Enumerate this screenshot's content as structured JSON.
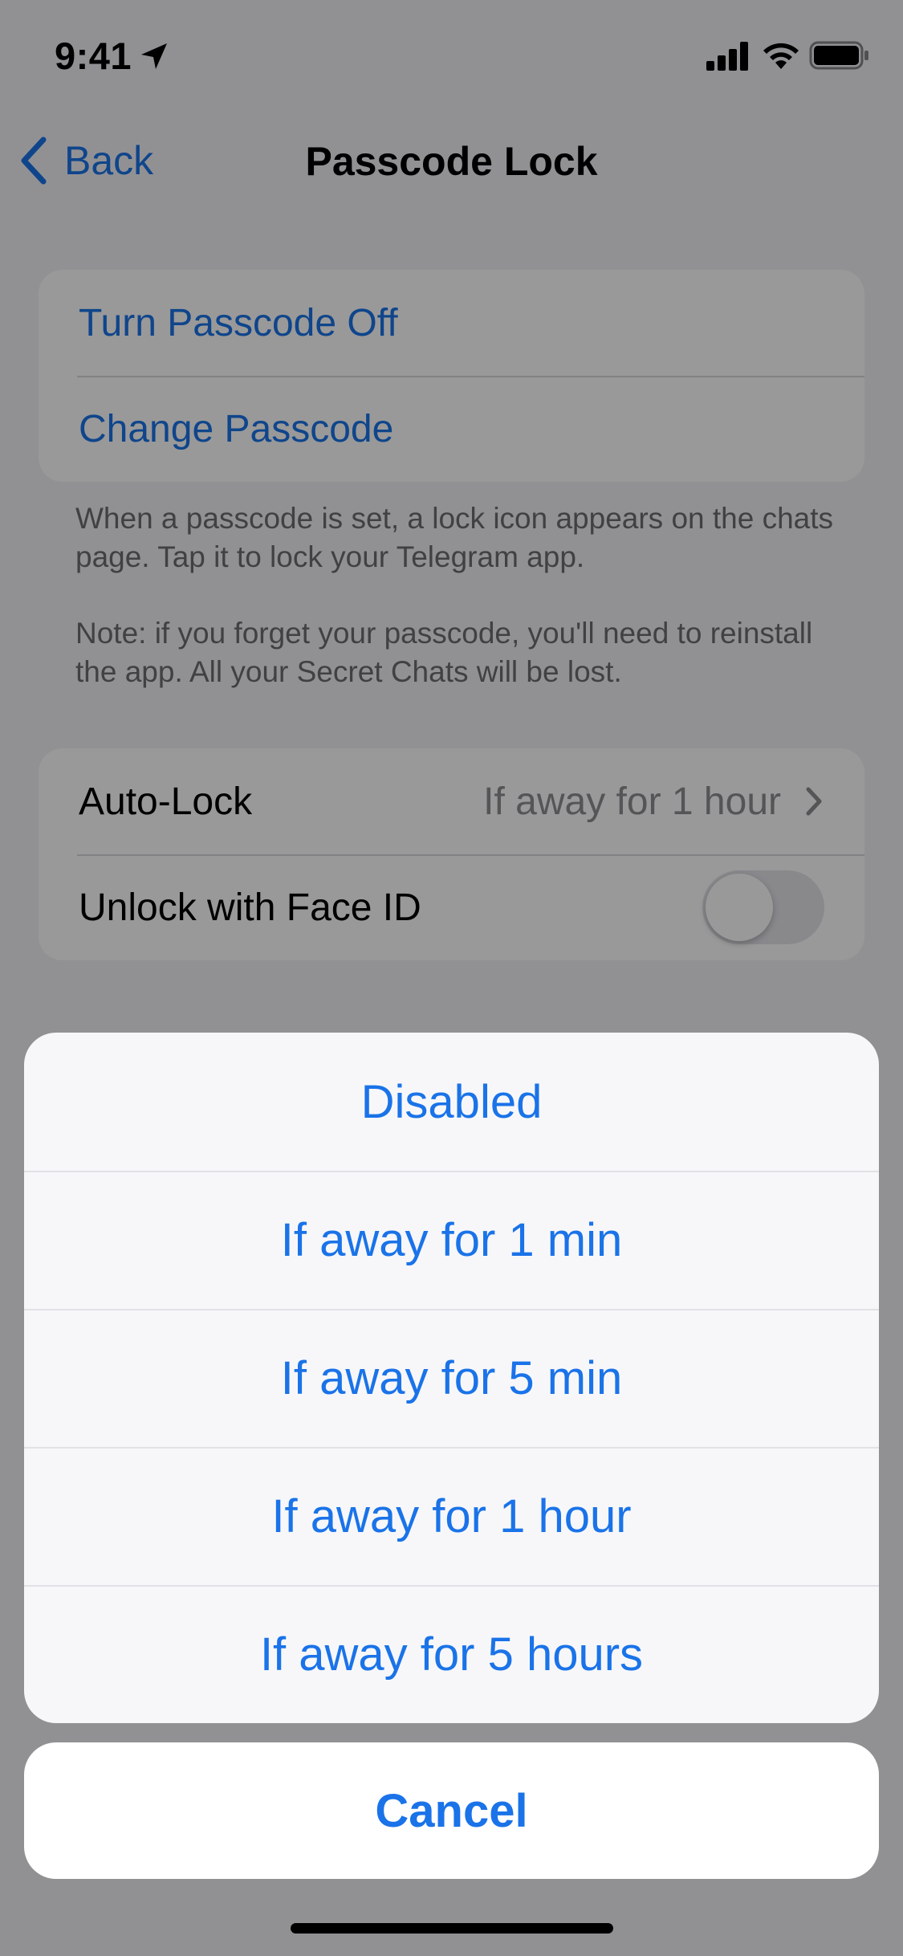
{
  "status": {
    "time": "9:41"
  },
  "nav": {
    "back_label": "Back",
    "title": "Passcode Lock"
  },
  "passcode_group": {
    "items": [
      {
        "label": "Turn Passcode Off"
      },
      {
        "label": "Change Passcode"
      }
    ]
  },
  "notes": {
    "info": "When a passcode is set, a lock icon appears on the chats page. Tap it to lock your Telegram app.",
    "warning": "Note: if you forget your passcode, you'll need to reinstall the app. All your Secret Chats will be lost."
  },
  "settings_group": {
    "auto_lock_label": "Auto-Lock",
    "auto_lock_value": "If away for 1 hour",
    "face_id_label": "Unlock with Face ID",
    "face_id_enabled": false
  },
  "action_sheet": {
    "options": [
      {
        "label": "Disabled"
      },
      {
        "label": "If away for 1 min"
      },
      {
        "label": "If away for 5 min"
      },
      {
        "label": "If away for 1 hour"
      },
      {
        "label": "If away for 5 hours"
      }
    ],
    "cancel_label": "Cancel"
  },
  "colors": {
    "accent": "#1a73e8",
    "background": "#f2f2f7",
    "secondary_text": "#6d6d72"
  },
  "icons": [
    "location-arrow-icon",
    "cellular-signal-icon",
    "wifi-icon",
    "battery-icon",
    "chevron-left-icon",
    "chevron-right-icon"
  ]
}
